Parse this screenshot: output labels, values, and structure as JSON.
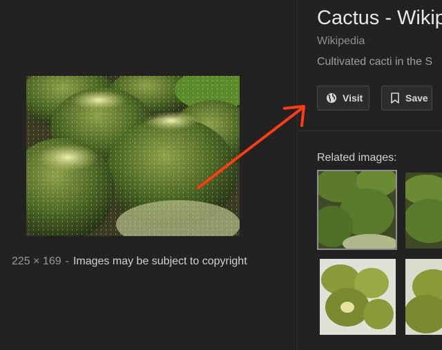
{
  "result": {
    "title": "Cactus - Wikip",
    "source": "Wikipedia",
    "description": "Cultivated cacti in the S"
  },
  "actions": {
    "visit_label": "Visit",
    "save_label": "Save"
  },
  "related": {
    "label": "Related images:"
  },
  "image_info": {
    "dimensions": "225 × 169",
    "separator": "-",
    "copyright_note": "Images may be subject to copyright"
  },
  "colors": {
    "background": "#222222",
    "annotation_arrow": "#ff3b14",
    "button_border": "#4a4a4a"
  },
  "icons": {
    "visit": "globe-icon",
    "save": "bookmark-icon"
  }
}
